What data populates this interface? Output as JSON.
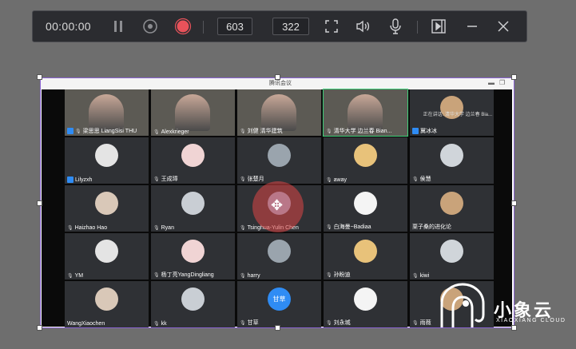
{
  "toolbar": {
    "timer": "00:00:00",
    "width_value": "603",
    "height_value": "322",
    "times": "×",
    "icons": [
      "pause-icon",
      "stop-icon",
      "record-icon",
      "fullscreen-icon",
      "volume-icon",
      "microphone-icon",
      "start-panel-icon",
      "minimize-icon",
      "close-icon"
    ],
    "record_color": "#e8525a"
  },
  "window": {
    "title": "腾讯会议",
    "speaking_label": "正在讲话: 清华大学 边兰春 Bia...",
    "accent": "#8a63d2"
  },
  "participants": [
    {
      "name": "梁思思 LiangSisi THU",
      "video": true,
      "mic": true,
      "host": true
    },
    {
      "name": "Alexkrieger",
      "video": true,
      "mic": true
    },
    {
      "name": "刘健 清华建筑",
      "video": true,
      "mic": true
    },
    {
      "name": "清华大学 边兰春 Bian...",
      "video": true,
      "mic": true,
      "active": true
    },
    {
      "name": "冀冰冰",
      "video": false,
      "host": true
    },
    {
      "name": "Lilyzxh",
      "video": false,
      "host": true
    },
    {
      "name": "王成璋",
      "video": false,
      "mic": true
    },
    {
      "name": "张楚月",
      "video": false,
      "mic": true
    },
    {
      "name": "away",
      "video": false,
      "mic": true
    },
    {
      "name": "侯慧",
      "video": false,
      "mic": true
    },
    {
      "name": "Haizhao Hao",
      "video": false,
      "mic": true
    },
    {
      "name": "Ryan",
      "video": false,
      "mic": true
    },
    {
      "name": "Tsinghua-Yulin Chen",
      "video": false,
      "mic": true
    },
    {
      "name": "白海曼~Badiaa",
      "video": false,
      "mic": true
    },
    {
      "name": "栗子桑的进化论",
      "video": false
    },
    {
      "name": "YM",
      "video": false,
      "mic": true
    },
    {
      "name": "杨丁亮YangDingliang",
      "video": false,
      "mic": true
    },
    {
      "name": "harry",
      "video": false,
      "mic": true
    },
    {
      "name": "孙盼迪",
      "video": false,
      "mic": true
    },
    {
      "name": "kiwi",
      "video": false,
      "mic": true
    },
    {
      "name": "WangXiaochen",
      "video": false
    },
    {
      "name": "kk",
      "video": false,
      "mic": true
    },
    {
      "name": "甘草",
      "video": false,
      "mic": true,
      "avatar_text": "甘草"
    },
    {
      "name": "刘永城",
      "video": false,
      "mic": true
    },
    {
      "name": "雨薇",
      "video": false,
      "mic": true
    }
  ],
  "watermark": {
    "brand": "小象云",
    "sub": "XIAOXIANG CLOUD"
  }
}
